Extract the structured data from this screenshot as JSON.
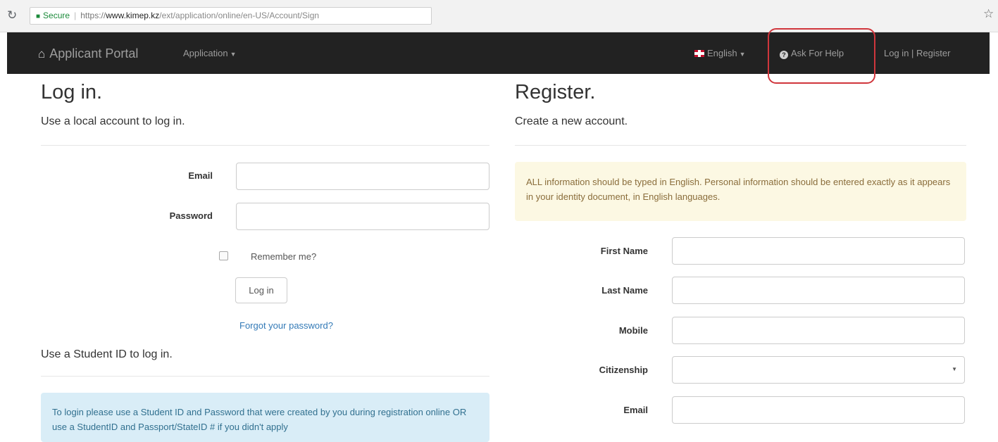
{
  "browser": {
    "secure_label": "Secure",
    "url_scheme": "https://",
    "url_host": "www.kimep.kz",
    "url_path": "/ext/application/online/en-US/Account/Sign"
  },
  "navbar": {
    "brand": "Applicant Portal",
    "application_menu": "Application",
    "language": "English",
    "help": "Ask For Help",
    "login_register": "Log in | Register"
  },
  "login": {
    "title": "Log in.",
    "subtitle": "Use a local account to log in.",
    "email_label": "Email",
    "password_label": "Password",
    "remember_label": "Remember me?",
    "login_button": "Log in",
    "forgot_link": "Forgot your password?",
    "student_subtitle": "Use a Student ID to log in.",
    "student_info": "To login please use a Student ID and Password that were created by you during registration online OR use a StudentID and Passport/StateID # if you didn't apply"
  },
  "register": {
    "title": "Register.",
    "subtitle": "Create a new account.",
    "notice": "ALL information should be typed in English. Personal information should be entered exactly as it appears in your identity document, in English languages.",
    "first_name_label": "First Name",
    "last_name_label": "Last Name",
    "mobile_label": "Mobile",
    "citizenship_label": "Citizenship",
    "email_label": "Email"
  },
  "colors": {
    "navbar_bg": "#222222",
    "link": "#337ab7",
    "highlight_ring": "#d0363c",
    "info_bg": "#d9edf7",
    "warning_bg": "#fcf8e3"
  }
}
